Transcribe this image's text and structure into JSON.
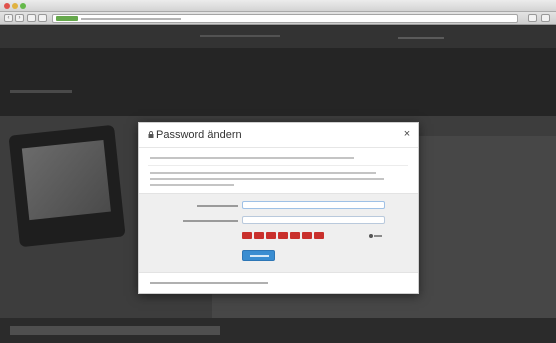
{
  "modal": {
    "title": "Password ändern",
    "close_glyph": "×",
    "lock_icon": "lock-icon"
  },
  "form": {
    "strength_segments": 7,
    "strength_color": "#c9302c",
    "submit_color": "#3a8dd1"
  },
  "colors": {
    "accent": "#3a8dd1",
    "secure_badge": "#66a84c",
    "overlay_dim": "#2e2e2e"
  }
}
